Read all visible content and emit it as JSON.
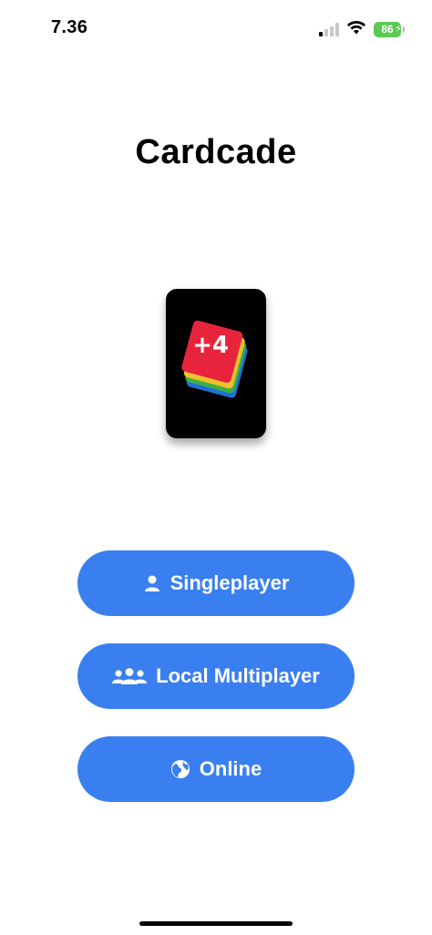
{
  "status_bar": {
    "time": "7.36",
    "battery_level": "86",
    "battery_color": "#5cc954",
    "signal_bars_active": 1,
    "signal_bars_total": 4,
    "icons": [
      "signal-icon",
      "wifi-icon",
      "battery-icon",
      "charging-bolt-icon"
    ]
  },
  "app": {
    "title": "Cardcade",
    "card_face_text": "+4",
    "card_colors": [
      "#e8243c",
      "#f2c12e",
      "#3cb043",
      "#1f6fd6"
    ]
  },
  "menu": {
    "singleplayer_label": "Singleplayer",
    "local_multiplayer_label": "Local Multiplayer",
    "online_label": "Online",
    "button_color": "#3a7ff0",
    "button_icons": [
      "person-icon",
      "people-icon",
      "globe-icon"
    ]
  }
}
